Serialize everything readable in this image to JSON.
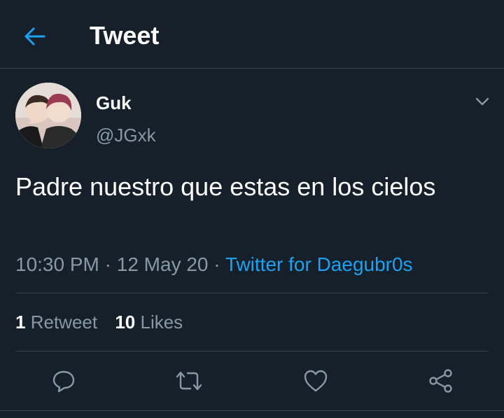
{
  "header": {
    "title": "Tweet",
    "back_icon": "arrow-left-icon"
  },
  "tweet": {
    "display_name": "Guk",
    "handle": "@JGxk",
    "text": "Padre nuestro que estas en los cielos",
    "time": "10:30 PM",
    "date": "12 May 20",
    "separator": "·",
    "source": "Twitter for Daegubr0s",
    "retweet_count": "1",
    "retweet_label": "Retweet",
    "like_count": "10",
    "like_label": "Likes"
  },
  "actions": [
    "reply-icon",
    "retweet-icon",
    "like-icon",
    "share-icon"
  ],
  "colors": {
    "background": "#15202b",
    "accent": "#1da1f2",
    "secondary_text": "#8899a6",
    "divider": "#38444d"
  }
}
